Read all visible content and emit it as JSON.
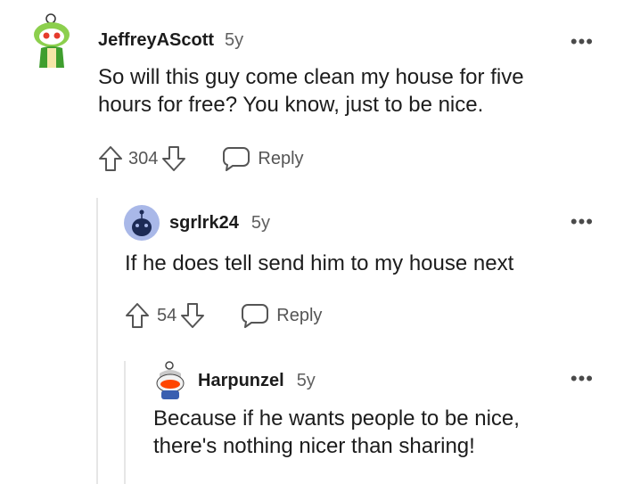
{
  "comments": [
    {
      "username": "JeffreyAScott",
      "age": "5y",
      "body_lines": [
        "So will this guy come clean my house for five",
        "hours for free? You know, just to be nice."
      ],
      "votes": "304",
      "reply_label": "Reply",
      "more_label": "•••",
      "avatar_icon": "snoo-green-avatar-icon"
    },
    {
      "username": "sgrlrk24",
      "age": "5y",
      "body_lines": [
        "If he does tell send him to my house next"
      ],
      "votes": "54",
      "reply_label": "Reply",
      "more_label": "•••",
      "avatar_icon": "snoo-default-avatar-icon"
    },
    {
      "username": "Harpunzel",
      "age": "5y",
      "body_lines": [
        "Because if he wants people to be nice,",
        "there's nothing nicer than sharing!"
      ],
      "more_label": "•••",
      "avatar_icon": "snoo-orange-avatar-icon"
    }
  ],
  "colors": {
    "text": "#1c1c1c",
    "muted": "#5f5f5f",
    "thread_line": "#e6e6e6",
    "avatar_blue": "#a9b8e8"
  }
}
